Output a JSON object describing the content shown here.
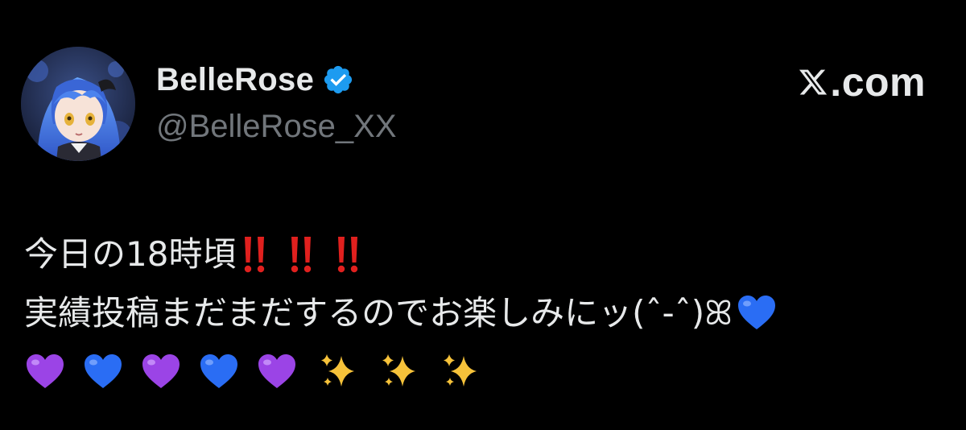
{
  "header": {
    "display_name": "BelleRose",
    "handle": "@BelleRose_XX",
    "verified_icon": "verified-badge-icon",
    "avatar": "anime-avatar-blue-hair",
    "brand_text": ".com",
    "brand_icon": "x-logo-icon"
  },
  "tweet": {
    "line1_text": "今日の18時頃",
    "line1_emojis": [
      "double-exclamation-icon",
      "double-exclamation-icon",
      "double-exclamation-icon"
    ],
    "line2_text": "実績投稿まだまだするのでお楽しみにッ(ˆ-ˆ)ꕤ",
    "line2_emojis": [
      "blue-heart-icon"
    ],
    "line3_emojis": [
      "purple-heart-icon",
      "blue-heart-icon",
      "purple-heart-icon",
      "blue-heart-icon",
      "purple-heart-icon",
      "sparkles-icon",
      "sparkles-icon",
      "sparkles-icon"
    ]
  },
  "colors": {
    "background": "#000000",
    "text_primary": "#e7e9ea",
    "text_secondary": "#71767b",
    "verified_blue": "#1d9bf0",
    "exclamation_red": "#e0201e",
    "blue_heart": "#2a6df4",
    "purple_heart": "#9b44e6",
    "sparkle_gold": "#f6c23a"
  }
}
